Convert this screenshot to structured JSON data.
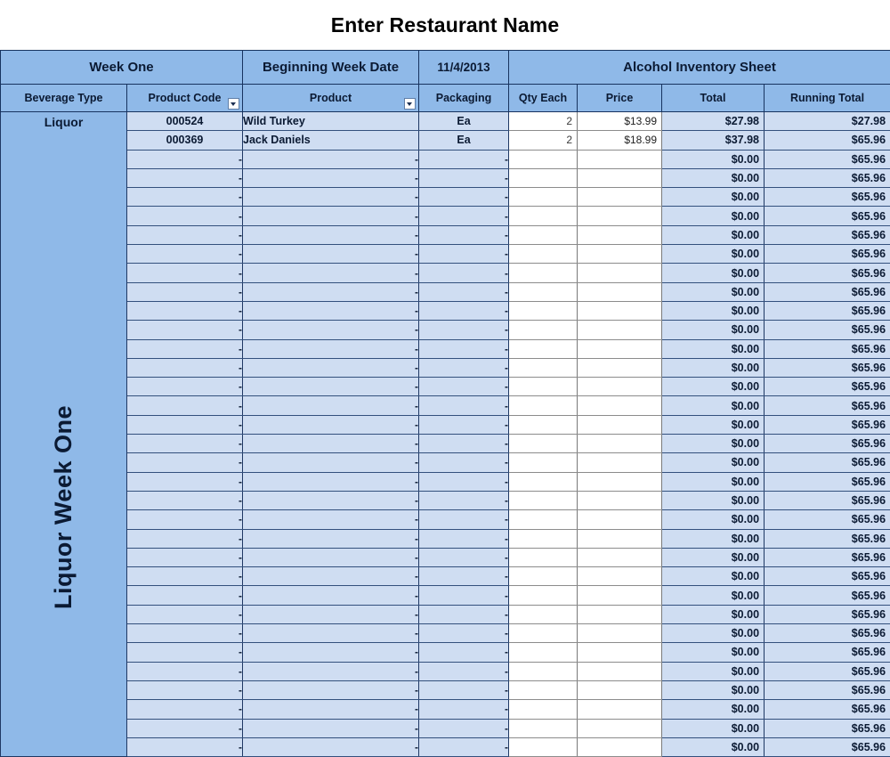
{
  "title": "Enter Restaurant Name",
  "banner": {
    "week": "Week One",
    "begin_date_label": "Beginning Week Date",
    "begin_date_value": "11/4/2013",
    "sheet_title": "Alcohol Inventory Sheet"
  },
  "columns": {
    "beverage_type": "Beverage Type",
    "product_code": "Product Code",
    "product": "Product",
    "packaging": "Packaging",
    "qty_each": "Qty Each",
    "price": "Price",
    "total": "Total",
    "running_total": "Running Total"
  },
  "beverage": {
    "type_label": "Liquor",
    "section_label": "Liquor Week One"
  },
  "placeholders": {
    "dash": "-",
    "zero_total": "$0.00",
    "carry_running_total": "$65.96"
  },
  "colors": {
    "header_blue": "#8FB9E8",
    "row_blue": "#CFDDF2",
    "border_dark": "#1F3864",
    "white": "#FFFFFF"
  },
  "icons": {
    "filter_dropdown": "chevron-down-icon"
  },
  "rows": [
    {
      "code": "000524",
      "product": "Wild Turkey",
      "packaging": "Ea",
      "qty": "2",
      "price": "$13.99",
      "total": "$27.98",
      "running": "$27.98"
    },
    {
      "code": "000369",
      "product": "Jack Daniels",
      "packaging": "Ea",
      "qty": "2",
      "price": "$18.99",
      "total": "$37.98",
      "running": "$65.96"
    },
    {
      "code": "-",
      "product": "-",
      "packaging": "-",
      "qty": "",
      "price": "",
      "total": "$0.00",
      "running": "$65.96"
    },
    {
      "code": "-",
      "product": "-",
      "packaging": "-",
      "qty": "",
      "price": "",
      "total": "$0.00",
      "running": "$65.96"
    },
    {
      "code": "-",
      "product": "-",
      "packaging": "-",
      "qty": "",
      "price": "",
      "total": "$0.00",
      "running": "$65.96"
    },
    {
      "code": "-",
      "product": "-",
      "packaging": "-",
      "qty": "",
      "price": "",
      "total": "$0.00",
      "running": "$65.96"
    },
    {
      "code": "-",
      "product": "-",
      "packaging": "-",
      "qty": "",
      "price": "",
      "total": "$0.00",
      "running": "$65.96"
    },
    {
      "code": "-",
      "product": "-",
      "packaging": "-",
      "qty": "",
      "price": "",
      "total": "$0.00",
      "running": "$65.96"
    },
    {
      "code": "-",
      "product": "-",
      "packaging": "-",
      "qty": "",
      "price": "",
      "total": "$0.00",
      "running": "$65.96"
    },
    {
      "code": "-",
      "product": "-",
      "packaging": "-",
      "qty": "",
      "price": "",
      "total": "$0.00",
      "running": "$65.96"
    },
    {
      "code": "-",
      "product": "-",
      "packaging": "-",
      "qty": "",
      "price": "",
      "total": "$0.00",
      "running": "$65.96"
    },
    {
      "code": "-",
      "product": "-",
      "packaging": "-",
      "qty": "",
      "price": "",
      "total": "$0.00",
      "running": "$65.96"
    },
    {
      "code": "-",
      "product": "-",
      "packaging": "-",
      "qty": "",
      "price": "",
      "total": "$0.00",
      "running": "$65.96"
    },
    {
      "code": "-",
      "product": "-",
      "packaging": "-",
      "qty": "",
      "price": "",
      "total": "$0.00",
      "running": "$65.96"
    },
    {
      "code": "-",
      "product": "-",
      "packaging": "-",
      "qty": "",
      "price": "",
      "total": "$0.00",
      "running": "$65.96"
    },
    {
      "code": "-",
      "product": "-",
      "packaging": "-",
      "qty": "",
      "price": "",
      "total": "$0.00",
      "running": "$65.96"
    },
    {
      "code": "-",
      "product": "-",
      "packaging": "-",
      "qty": "",
      "price": "",
      "total": "$0.00",
      "running": "$65.96"
    },
    {
      "code": "-",
      "product": "-",
      "packaging": "-",
      "qty": "",
      "price": "",
      "total": "$0.00",
      "running": "$65.96"
    },
    {
      "code": "-",
      "product": "-",
      "packaging": "-",
      "qty": "",
      "price": "",
      "total": "$0.00",
      "running": "$65.96"
    },
    {
      "code": "-",
      "product": "-",
      "packaging": "-",
      "qty": "",
      "price": "",
      "total": "$0.00",
      "running": "$65.96"
    },
    {
      "code": "-",
      "product": "-",
      "packaging": "-",
      "qty": "",
      "price": "",
      "total": "$0.00",
      "running": "$65.96"
    },
    {
      "code": "-",
      "product": "-",
      "packaging": "-",
      "qty": "",
      "price": "",
      "total": "$0.00",
      "running": "$65.96"
    },
    {
      "code": "-",
      "product": "-",
      "packaging": "-",
      "qty": "",
      "price": "",
      "total": "$0.00",
      "running": "$65.96"
    },
    {
      "code": "-",
      "product": "-",
      "packaging": "-",
      "qty": "",
      "price": "",
      "total": "$0.00",
      "running": "$65.96"
    },
    {
      "code": "-",
      "product": "-",
      "packaging": "-",
      "qty": "",
      "price": "",
      "total": "$0.00",
      "running": "$65.96"
    },
    {
      "code": "-",
      "product": "-",
      "packaging": "-",
      "qty": "",
      "price": "",
      "total": "$0.00",
      "running": "$65.96"
    },
    {
      "code": "-",
      "product": "-",
      "packaging": "-",
      "qty": "",
      "price": "",
      "total": "$0.00",
      "running": "$65.96"
    },
    {
      "code": "-",
      "product": "-",
      "packaging": "-",
      "qty": "",
      "price": "",
      "total": "$0.00",
      "running": "$65.96"
    },
    {
      "code": "-",
      "product": "-",
      "packaging": "-",
      "qty": "",
      "price": "",
      "total": "$0.00",
      "running": "$65.96"
    },
    {
      "code": "-",
      "product": "-",
      "packaging": "-",
      "qty": "",
      "price": "",
      "total": "$0.00",
      "running": "$65.96"
    },
    {
      "code": "-",
      "product": "-",
      "packaging": "-",
      "qty": "",
      "price": "",
      "total": "$0.00",
      "running": "$65.96"
    },
    {
      "code": "-",
      "product": "-",
      "packaging": "-",
      "qty": "",
      "price": "",
      "total": "$0.00",
      "running": "$65.96"
    },
    {
      "code": "-",
      "product": "-",
      "packaging": "-",
      "qty": "",
      "price": "",
      "total": "$0.00",
      "running": "$65.96"
    },
    {
      "code": "-",
      "product": "-",
      "packaging": "-",
      "qty": "",
      "price": "",
      "total": "$0.00",
      "running": "$65.96"
    }
  ]
}
